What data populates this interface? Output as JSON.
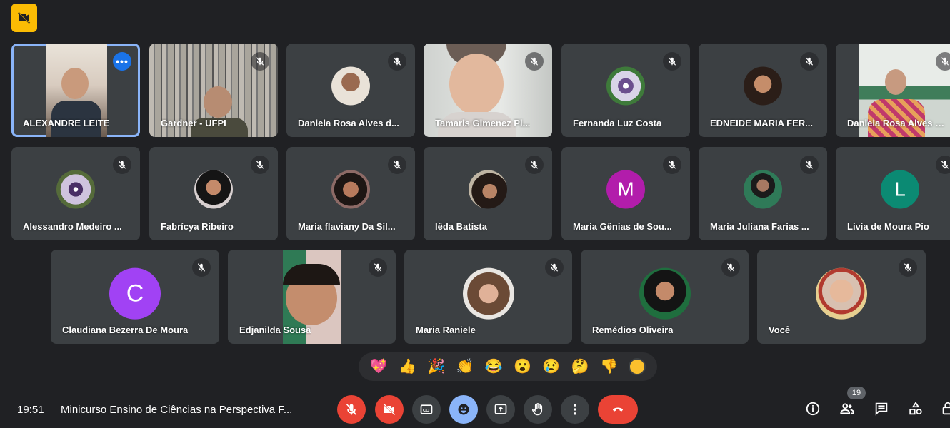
{
  "meeting": {
    "time": "19:51",
    "title": "Minicurso Ensino de Ciências na Perspectiva F..."
  },
  "participants": [
    {
      "name": "ALEXANDRE LEITE",
      "type": "video",
      "mic": "on",
      "active": true
    },
    {
      "name": "Gardner - UFPI",
      "type": "video",
      "mic": "muted"
    },
    {
      "name": "Daniela Rosa Alves d...",
      "type": "photo",
      "mic": "muted"
    },
    {
      "name": "Tamaris Gimenez Pi...",
      "type": "video",
      "mic": "muted"
    },
    {
      "name": "Fernanda Luz Costa",
      "type": "photo",
      "mic": "muted"
    },
    {
      "name": "EDNEIDE MARIA FER...",
      "type": "photo",
      "mic": "muted"
    },
    {
      "name": "Daniela Rosa Alves d...",
      "type": "video",
      "mic": "muted"
    },
    {
      "name": "Alessandro Medeiro ...",
      "type": "photo",
      "mic": "muted"
    },
    {
      "name": "Fabrícya Ribeiro",
      "type": "photo",
      "mic": "muted"
    },
    {
      "name": "Maria flaviany Da Sil...",
      "type": "photo",
      "mic": "muted"
    },
    {
      "name": "Iêda Batista",
      "type": "photo",
      "mic": "muted"
    },
    {
      "name": "Maria Gênias de Sou...",
      "type": "letter",
      "letter": "M",
      "color": "#b21dab",
      "mic": "muted"
    },
    {
      "name": "Maria Juliana Farias ...",
      "type": "photo",
      "mic": "muted"
    },
    {
      "name": "Livia de Moura Pio",
      "type": "letter",
      "letter": "L",
      "color": "#0b8a73",
      "mic": "muted"
    },
    {
      "name": "Claudiana Bezerra De Moura",
      "type": "letter",
      "letter": "C",
      "color": "#a142f4",
      "mic": "muted"
    },
    {
      "name": "Edjanilda Sousa",
      "type": "video",
      "mic": "muted"
    },
    {
      "name": "Maria Raniele",
      "type": "photo",
      "mic": "muted"
    },
    {
      "name": "Remédios Oliveira",
      "type": "photo",
      "mic": "muted"
    },
    {
      "name": "Você",
      "type": "photo",
      "mic": "muted"
    }
  ],
  "reactions": [
    "💖",
    "👍",
    "🎉",
    "👏",
    "😂",
    "😮",
    "😢",
    "🤔",
    "👎"
  ],
  "toolbar": {
    "people_count": "19"
  },
  "icons": {
    "top_badge": "video-off-icon",
    "mic": "mic-off-icon",
    "more": "more-options-icon",
    "reaction_skin": "skin-tone-icon"
  },
  "colors": {
    "background": "#202124",
    "tile": "#3c4043",
    "danger": "#ea4335",
    "accent": "#8ab4f8",
    "badge": "#fbbc04"
  }
}
